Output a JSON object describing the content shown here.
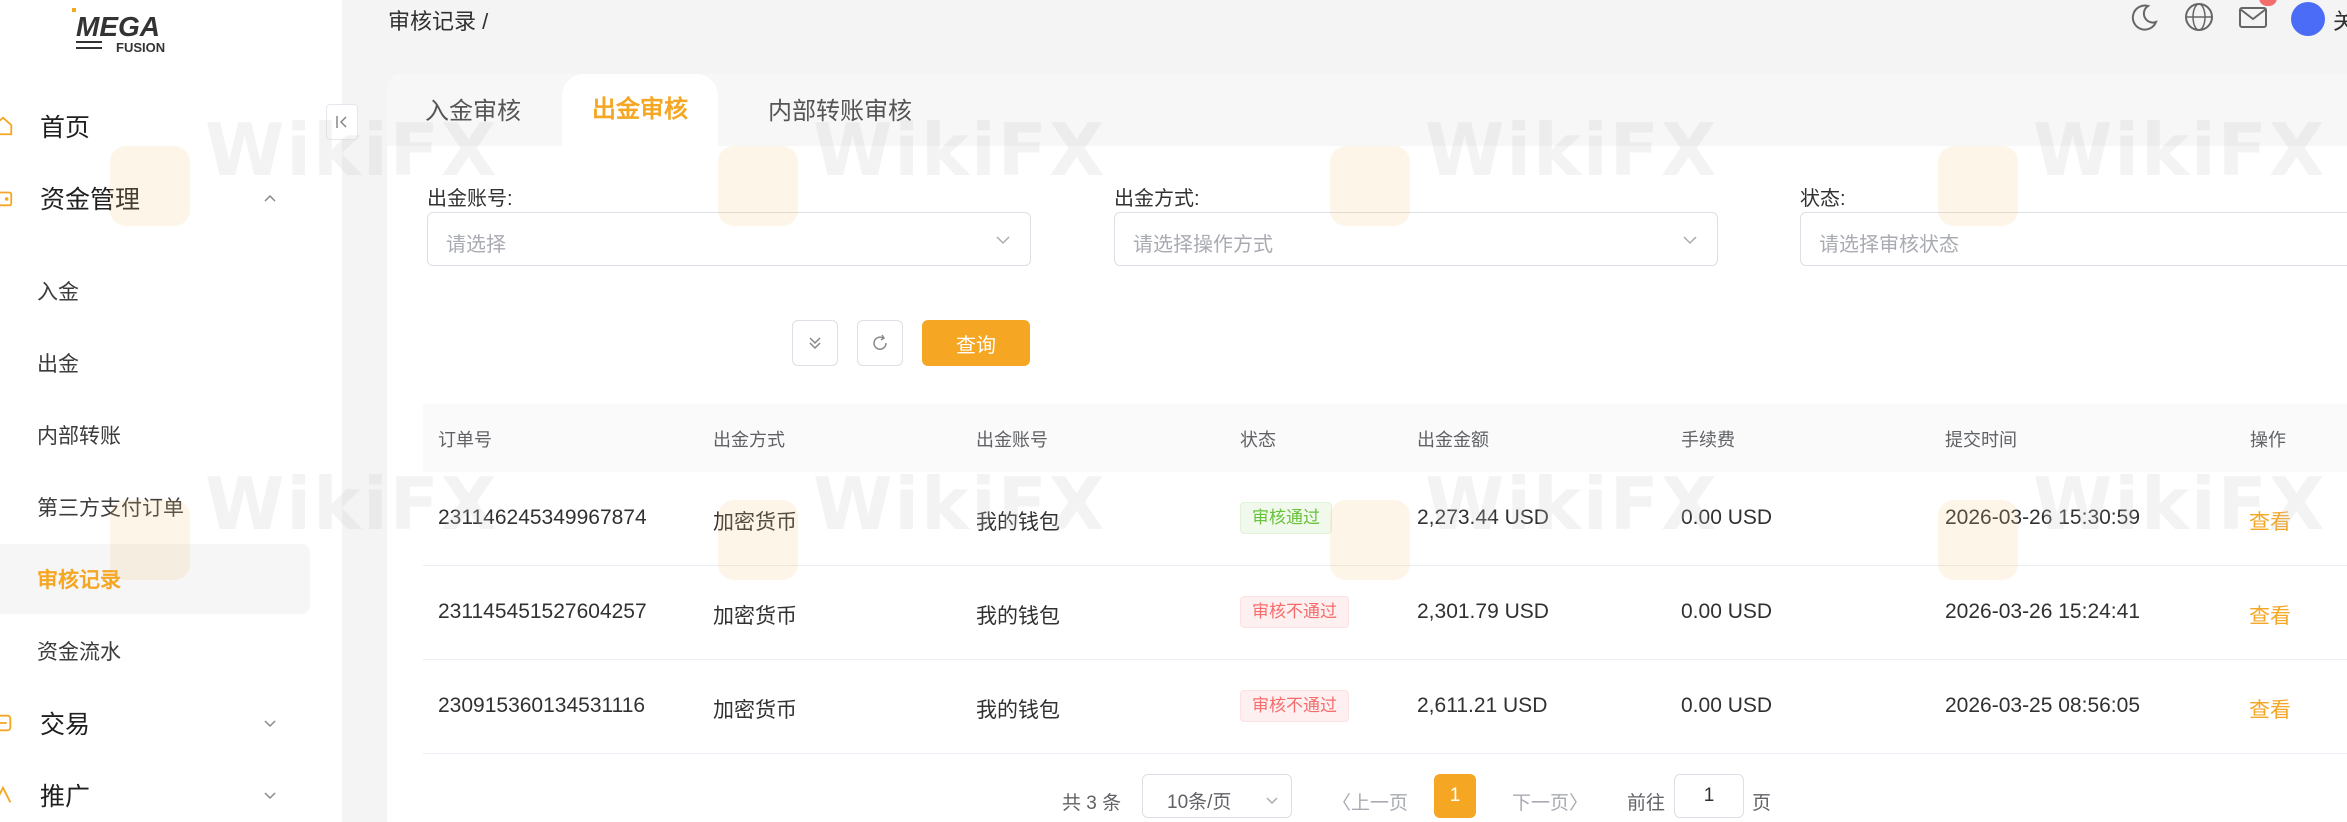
{
  "brand": {
    "logo_main": "MEGA",
    "logo_sub": "FUSION"
  },
  "sidebar": {
    "items": [
      {
        "label": "首页",
        "icon": "home-icon",
        "top": true
      },
      {
        "label": "资金管理",
        "icon": "wallet-icon",
        "top": true,
        "expanded": true
      },
      {
        "label": "入金"
      },
      {
        "label": "出金"
      },
      {
        "label": "内部转账"
      },
      {
        "label": "第三方支付订单"
      },
      {
        "label": "审核记录",
        "active": true
      },
      {
        "label": "资金流水"
      },
      {
        "label": "交易",
        "icon": "trade-icon",
        "top": true
      },
      {
        "label": "推广",
        "icon": "promo-icon",
        "top": true
      }
    ]
  },
  "header": {
    "breadcrumb": "审核记录 /",
    "username": "关"
  },
  "tabs": [
    {
      "label": "入金审核"
    },
    {
      "label": "出金审核",
      "active": true
    },
    {
      "label": "内部转账审核"
    }
  ],
  "filters": {
    "account": {
      "label": "出金账号:",
      "placeholder": "请选择"
    },
    "method": {
      "label": "出金方式:",
      "placeholder": "请选择操作方式"
    },
    "status": {
      "label": "状态:",
      "placeholder": "请选择审核状态"
    },
    "query_label": "查询"
  },
  "table": {
    "columns": [
      "订单号",
      "出金方式",
      "出金账号",
      "状态",
      "出金金额",
      "手续费",
      "提交时间",
      "操作"
    ],
    "rows": [
      {
        "order_id": "231146245349967874",
        "method": "加密货币",
        "account": "我的钱包",
        "status": "审核通过",
        "status_type": "pass",
        "amount": "2,273.44 USD",
        "fee": "0.00 USD",
        "submit_time": "2026-03-26 15:30:59",
        "action": "查看"
      },
      {
        "order_id": "231145451527604257",
        "method": "加密货币",
        "account": "我的钱包",
        "status": "审核不通过",
        "status_type": "fail",
        "amount": "2,301.79 USD",
        "fee": "0.00 USD",
        "submit_time": "2026-03-26 15:24:41",
        "action": "查看"
      },
      {
        "order_id": "230915360134531116",
        "method": "加密货币",
        "account": "我的钱包",
        "status": "审核不通过",
        "status_type": "fail",
        "amount": "2,611.21 USD",
        "fee": "0.00 USD",
        "submit_time": "2026-03-25 08:56:05",
        "action": "查看"
      }
    ]
  },
  "pagination": {
    "total": "共 3 条",
    "page_size": "10条/页",
    "prev": "〈上一页",
    "current": "1",
    "next": "下一页〉",
    "goto_label": "前往",
    "goto_value": "1",
    "goto_suffix": "页"
  },
  "watermark": "WikiFX",
  "colors": {
    "accent": "#f5a623",
    "pass": "#67c23a",
    "fail": "#f56c6c"
  }
}
